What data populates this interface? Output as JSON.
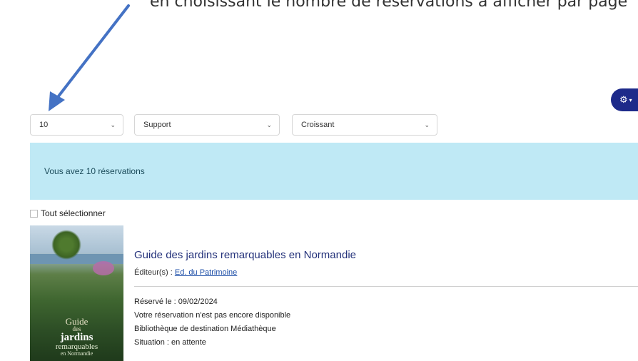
{
  "top_text": "en choisissant le nombre de réservations à afficher par page",
  "toolbar": {
    "settings_icon": "gear-icon"
  },
  "filters": {
    "per_page": "10",
    "support": "Support",
    "order": "Croissant"
  },
  "banner": {
    "message": "Vous avez 10 réservations"
  },
  "select_all_label": "Tout sélectionner",
  "cover": {
    "line1": "Guide",
    "line2": "des",
    "line3": "jardins",
    "line4": "remarquables",
    "line5": "en Normandie"
  },
  "reservation": {
    "title": "Guide des jardins remarquables en Normandie",
    "publisher_label": "Éditeur(s) : ",
    "publisher_link": "Ed. du Patrimoine",
    "reserved_on": "Réservé le : 09/02/2024",
    "availability": "Votre réservation n'est pas encore disponible",
    "destination": "Bibliothèque de destination Médiathèque",
    "status": "Situation : en attente"
  },
  "colors": {
    "banner_bg": "#bfe9f5",
    "title": "#23317a",
    "settings_button": "#1d2a8a",
    "arrow": "#4472c4"
  }
}
